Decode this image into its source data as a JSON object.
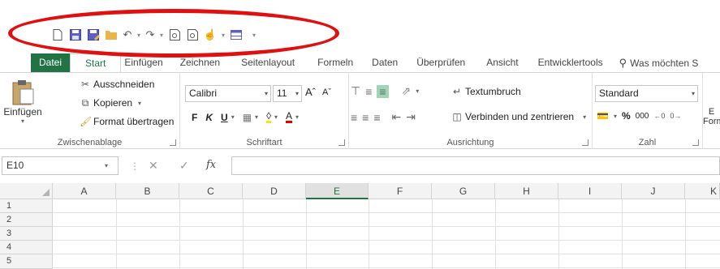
{
  "quick_access": {
    "icons": [
      "new-icon",
      "save-icon",
      "save-as-icon",
      "open-folder-icon",
      "undo-icon",
      "redo-icon",
      "print-preview-icon",
      "print-preview-2-icon",
      "touch-mode-icon",
      "table-icon",
      "customize-icon"
    ]
  },
  "tabs": [
    {
      "label": "Datei"
    },
    {
      "label": "Start"
    },
    {
      "label": "Einfügen"
    },
    {
      "label": "Zeichnen"
    },
    {
      "label": "Seitenlayout"
    },
    {
      "label": "Formeln"
    },
    {
      "label": "Daten"
    },
    {
      "label": "Überprüfen"
    },
    {
      "label": "Ansicht"
    },
    {
      "label": "Entwicklertools"
    }
  ],
  "tell_me": "Was möchten S",
  "clipboard": {
    "paste_label": "Einfügen",
    "cut_label": "Ausschneiden",
    "copy_label": "Kopieren",
    "format_painter_label": "Format übertragen",
    "group_label": "Zwischenablage"
  },
  "font": {
    "font_name": "Calibri",
    "font_size": "11",
    "bold": "F",
    "italic": "K",
    "underline": "U",
    "group_label": "Schriftart"
  },
  "alignment": {
    "wrap_label": "Textumbruch",
    "merge_label": "Verbinden und zentrieren",
    "group_label": "Ausrichtung"
  },
  "number": {
    "format": "Standard",
    "percent": "%",
    "thousands": "000",
    "group_label": "Zahl"
  },
  "styles": {
    "cut_label_1": "E",
    "cut_label_2": "Form"
  },
  "formula_bar": {
    "name_box": "E10",
    "fx": "fx"
  },
  "grid": {
    "columns": [
      "A",
      "B",
      "C",
      "D",
      "E",
      "F",
      "G",
      "H",
      "I",
      "J",
      "K"
    ],
    "rows": [
      "1",
      "2",
      "3",
      "4",
      "5"
    ],
    "selected_column": "E"
  },
  "colors": {
    "excel_green": "#217346",
    "annotation_red": "#e01010"
  }
}
